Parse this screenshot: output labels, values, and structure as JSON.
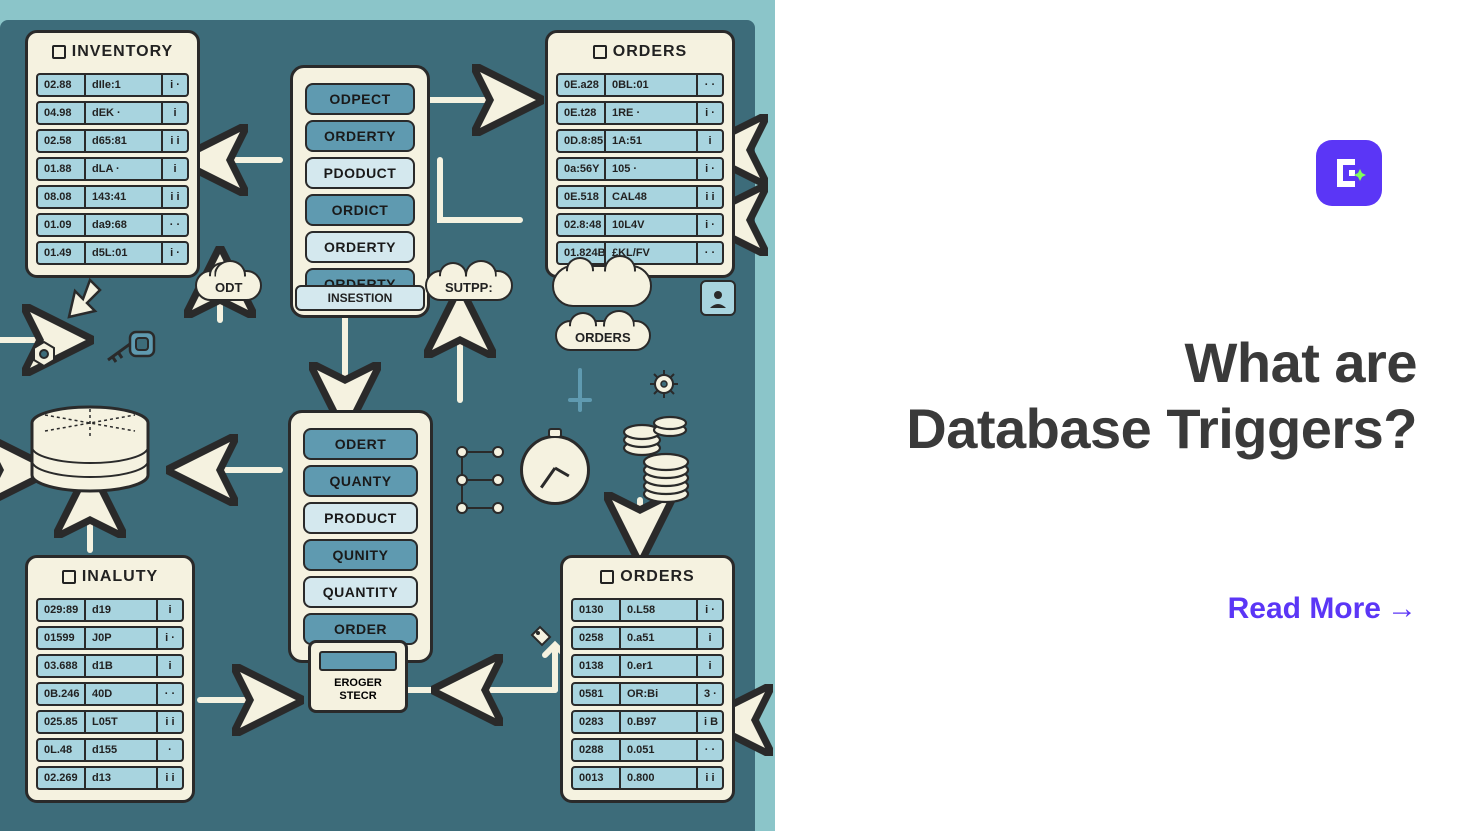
{
  "hero": {
    "title_line1": "What are",
    "title_line2": "Database Triggers?",
    "cta": "Read More"
  },
  "diagram": {
    "tables": {
      "inventory": {
        "title": "INVENTORY",
        "rows": [
          [
            "02.88",
            "dIle:1",
            "i ·"
          ],
          [
            "04.98",
            "dEK ·",
            "i"
          ],
          [
            "02.58",
            "d65:81",
            "i i"
          ],
          [
            "01.88",
            "dLA ·",
            "i"
          ],
          [
            "08.08",
            "143:41",
            "i i"
          ],
          [
            "01.09",
            "da9:68",
            "· ·"
          ],
          [
            "01.49",
            "d5L:01",
            "i ·"
          ]
        ]
      },
      "orders_top": {
        "title": "ORDERS",
        "rows": [
          [
            "0E.a28",
            "0BL:01",
            "· ·"
          ],
          [
            "0E.t28",
            "1RE ·",
            "i ·"
          ],
          [
            "0D.8:85",
            "1A:51",
            "i"
          ],
          [
            "0a:56Y",
            "105 ·",
            "i ·"
          ],
          [
            "0E.518",
            "CAL48",
            "i i"
          ],
          [
            "02.8:48",
            "10L4V",
            "i ·"
          ],
          [
            "01.824B",
            "£KL/FV",
            "· ·"
          ]
        ]
      },
      "inaluty": {
        "title": "INALUTY",
        "rows": [
          [
            "029:89",
            "d19",
            "i"
          ],
          [
            "01599",
            "J0P",
            "i ·"
          ],
          [
            "03.688",
            "d1B",
            "i"
          ],
          [
            "0B.246",
            "40D",
            "· ·"
          ],
          [
            "025.85",
            "L05T",
            "i i"
          ],
          [
            "0L.48",
            "d155",
            "·"
          ],
          [
            "02.269",
            "d13",
            "i i"
          ]
        ]
      },
      "orders_bottom": {
        "title": "ORDERS",
        "rows": [
          [
            "0130",
            "0.L58",
            "i ·"
          ],
          [
            "0258",
            "0.a51",
            "i"
          ],
          [
            "0138",
            "0.er1",
            "i"
          ],
          [
            "0581",
            "OR:Bi",
            "3 ·"
          ],
          [
            "0283",
            "0.B97",
            "i B"
          ],
          [
            "0288",
            "0.051",
            "· ·"
          ],
          [
            "0013",
            "0.800",
            "i i"
          ]
        ]
      }
    },
    "stacks": {
      "top": [
        "ODPECT",
        "ORDERTY",
        "PDODUCT",
        "ORDICT",
        "ORDERTY",
        "ORDERTY"
      ],
      "bottom": [
        "ODERT",
        "QUANTY",
        "PRODUCT",
        "QUNITY",
        "QUANTITY",
        "ORDER"
      ]
    },
    "labels": {
      "insestion": "INSESTION",
      "odt": "ODT",
      "sutpp": "SUTPP:",
      "orders_cloud": "ORDERS",
      "device": "EROGER STECR"
    }
  }
}
